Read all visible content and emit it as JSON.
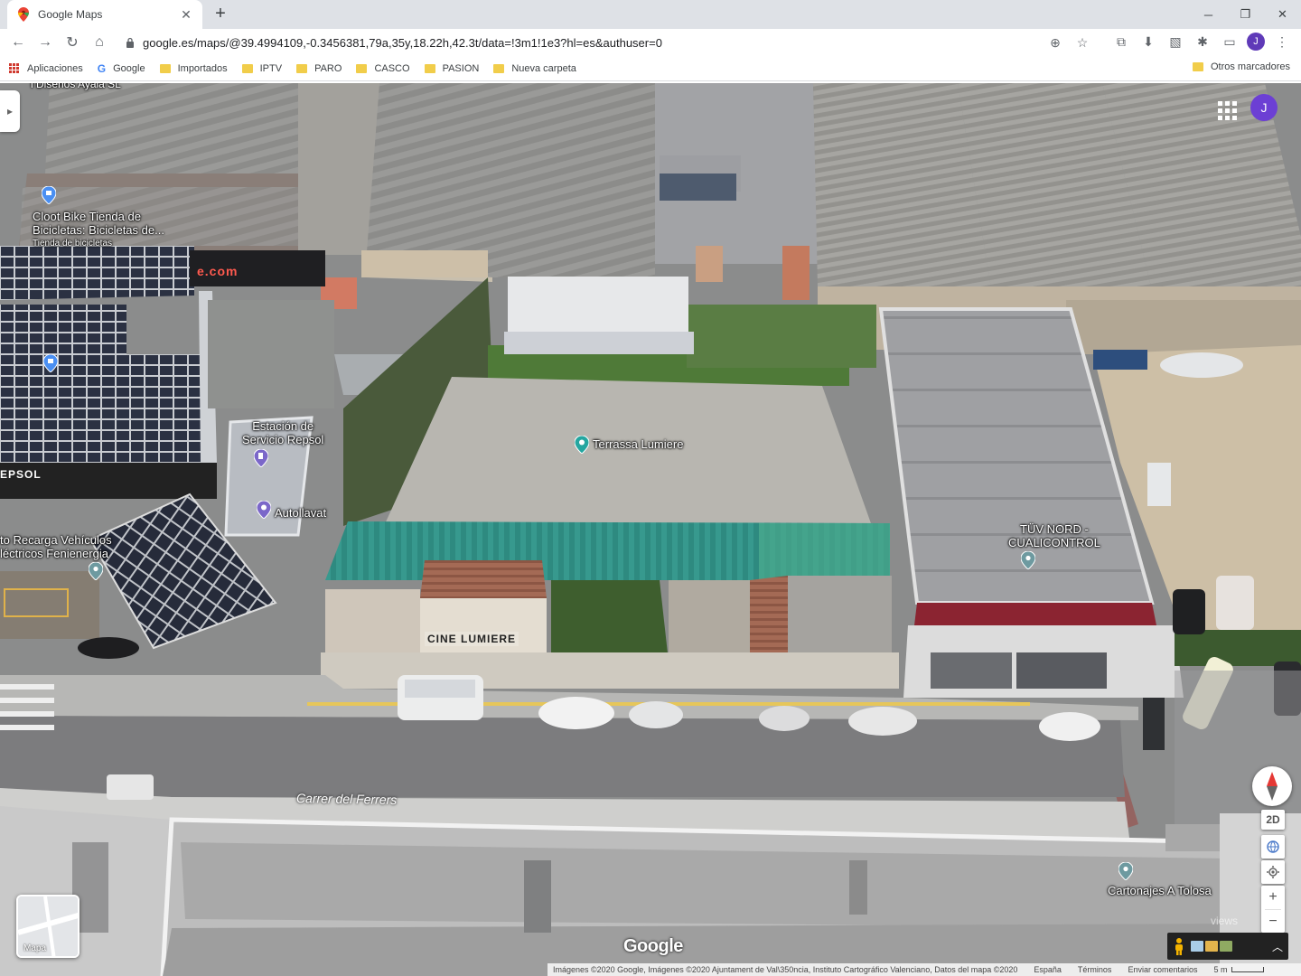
{
  "browser": {
    "tab_title": "Google Maps",
    "url": "google.es/maps/@39.4994109,-0.3456381,79a,35y,18.22h,42.3t/data=!3m1!1e3?hl=es&authuser=0",
    "profile_initial": "J"
  },
  "bookmarks": {
    "items": [
      "Aplicaciones",
      "Google",
      "Importados",
      "IPTV",
      "PARO",
      "CASCO",
      "PASION",
      "Nueva carpeta"
    ],
    "other": "Otros marcadores"
  },
  "map": {
    "avatar_initial": "J",
    "places": [
      {
        "name": "Cloot Bike Tienda de\nBicicletas: Bicicletas de...",
        "category": "Tienda de bicicletas"
      },
      {
        "name": "Estación de\nServicio Repsol"
      },
      {
        "name": "Autollavat"
      },
      {
        "name": "Terrassa Lumiere"
      },
      {
        "name": "TÜV NORD -\nCUALICONTROL"
      },
      {
        "name": "to Recarga Vehículos\nléctricos Fenienergia"
      },
      {
        "name": "Cartonajes A Tolosa"
      }
    ],
    "top_cut_label": "l Diseños Ayala SL",
    "street_name": "Carrer del Ferrers",
    "cine_sign": "CINE LUMIERE",
    "roof_sign": "e.com",
    "repsol_sign": "EPSOL",
    "layer_label": "Mapa",
    "mode_2d": "2D",
    "watermark": "Google",
    "views_watermark": "views",
    "attribution": {
      "imagery": "Imágenes ©2020 Google, Imágenes ©2020 Ajuntament de Val\\350ncia, Instituto Cartográfico Valenciano, Datos del mapa ©2020",
      "country": "España",
      "terms": "Términos",
      "feedback": "Enviar comentarios",
      "scale": "5 m"
    }
  }
}
